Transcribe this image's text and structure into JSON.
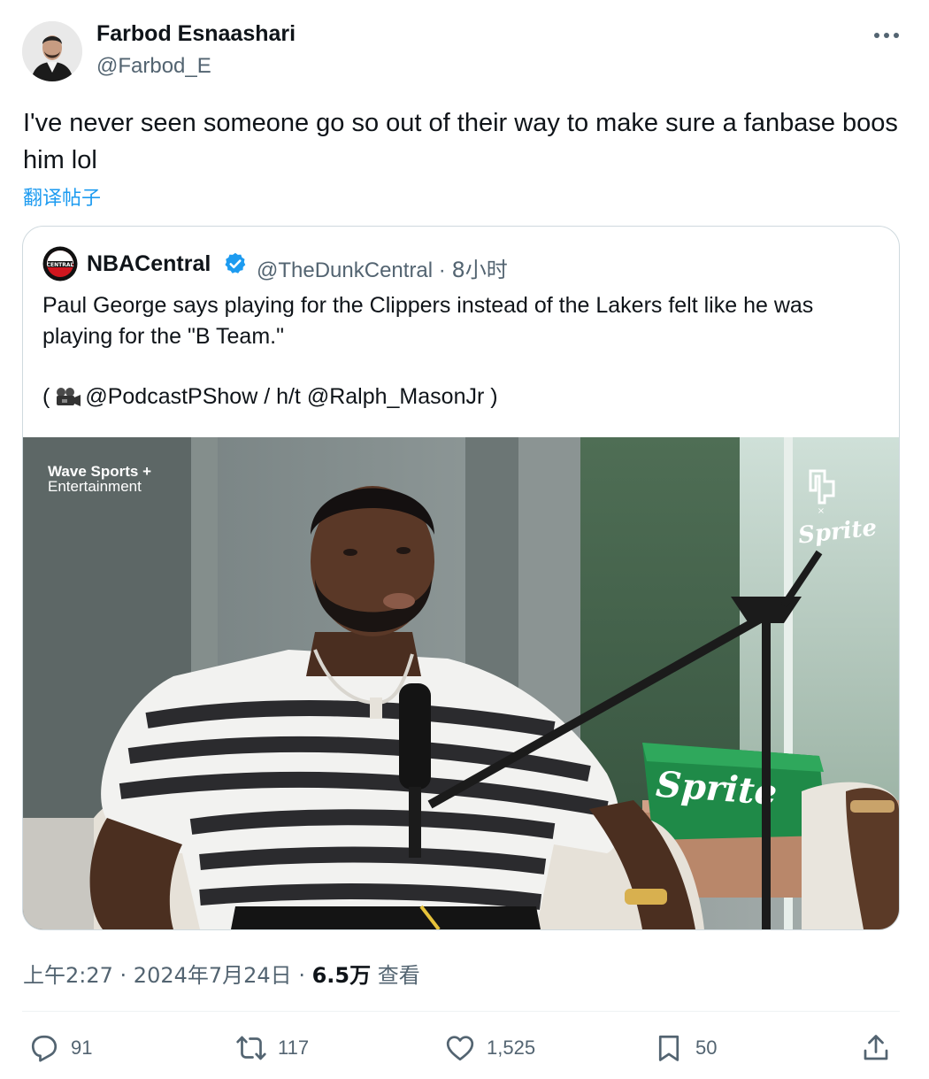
{
  "tweet": {
    "author_name": "Farbod Esnaashari",
    "author_handle": "@Farbod_E",
    "text": "I've never seen someone go so out of their way to make sure a fanbase boos him lol",
    "translate_label": "翻译帖子",
    "more_icon": "more-horizontal-icon"
  },
  "quote": {
    "name": "NBACentral",
    "handle": "@TheDunkCentral",
    "separator": " · ",
    "time": "8小时",
    "text": "Paul George says playing for the Clippers instead of the Lakers felt like he was playing for the \"B Team.\"",
    "credits_open": "(",
    "credits_rest": " @PodcastPShow / h/t @Ralph_MasonJr )",
    "video": {
      "watermark_line1": "Wave Sports +",
      "watermark_line2": "Entertainment",
      "sponsor": "Sprite",
      "box_brand": "Sprite"
    }
  },
  "meta": {
    "time": "上午2:27",
    "sep": " · ",
    "date": "2024年7月24日",
    "views_count": "6.5万",
    "views_label": " 查看"
  },
  "actions": {
    "replies": "91",
    "retweets": "117",
    "likes": "1,525",
    "bookmarks": "50"
  },
  "colors": {
    "accent": "#1d9bf0",
    "secondary_text": "#536471",
    "border": "#cfd9de"
  }
}
